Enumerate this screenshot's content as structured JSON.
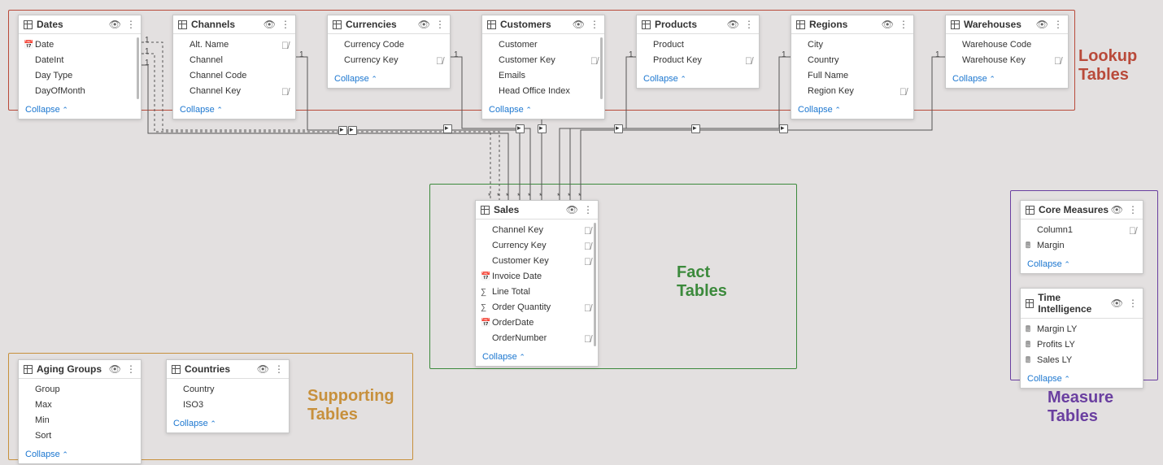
{
  "collapse_label": "Collapse",
  "groups": {
    "lookup": {
      "label": "Lookup\nTables",
      "color": "#b94a3a"
    },
    "fact": {
      "label": "Fact\nTables",
      "color": "#3c8a3c"
    },
    "support": {
      "label": "Supporting\nTables",
      "color": "#c7903c"
    },
    "measure": {
      "label": "Measure\nTables",
      "color": "#6a3fa0"
    }
  },
  "tables": {
    "dates": {
      "title": "Dates",
      "fields": [
        {
          "name": "Date",
          "icon": "date"
        },
        {
          "name": "DateInt"
        },
        {
          "name": "Day Type"
        },
        {
          "name": "DayOfMonth"
        }
      ]
    },
    "channels": {
      "title": "Channels",
      "fields": [
        {
          "name": "Alt. Name",
          "hidden": true
        },
        {
          "name": "Channel"
        },
        {
          "name": "Channel Code"
        },
        {
          "name": "Channel Key",
          "hidden": true
        }
      ]
    },
    "currencies": {
      "title": "Currencies",
      "fields": [
        {
          "name": "Currency Code"
        },
        {
          "name": "Currency Key",
          "hidden": true
        }
      ]
    },
    "customers": {
      "title": "Customers",
      "fields": [
        {
          "name": "Customer"
        },
        {
          "name": "Customer Key",
          "hidden": true
        },
        {
          "name": "Emails"
        },
        {
          "name": "Head Office Index"
        }
      ]
    },
    "products": {
      "title": "Products",
      "fields": [
        {
          "name": "Product"
        },
        {
          "name": "Product Key",
          "hidden": true
        }
      ]
    },
    "regions": {
      "title": "Regions",
      "fields": [
        {
          "name": "City"
        },
        {
          "name": "Country"
        },
        {
          "name": "Full Name"
        },
        {
          "name": "Region Key",
          "hidden": true
        }
      ]
    },
    "warehouses": {
      "title": "Warehouses",
      "fields": [
        {
          "name": "Warehouse Code"
        },
        {
          "name": "Warehouse Key",
          "hidden": true
        }
      ]
    },
    "sales": {
      "title": "Sales",
      "fields": [
        {
          "name": "Channel Key",
          "hidden": true
        },
        {
          "name": "Currency Key",
          "hidden": true
        },
        {
          "name": "Customer Key",
          "hidden": true
        },
        {
          "name": "Invoice Date",
          "icon": "date"
        },
        {
          "name": "Line Total",
          "icon": "sum"
        },
        {
          "name": "Order Quantity",
          "icon": "sum",
          "hidden": true
        },
        {
          "name": "OrderDate",
          "icon": "date"
        },
        {
          "name": "OrderNumber",
          "hidden": true
        }
      ]
    },
    "aging": {
      "title": "Aging Groups",
      "fields": [
        {
          "name": "Group"
        },
        {
          "name": "Max"
        },
        {
          "name": "Min"
        },
        {
          "name": "Sort"
        }
      ]
    },
    "countries": {
      "title": "Countries",
      "fields": [
        {
          "name": "Country"
        },
        {
          "name": "ISO3"
        }
      ]
    },
    "core": {
      "title": "Core Measures",
      "fields": [
        {
          "name": "Column1",
          "hidden": true
        },
        {
          "name": "Margin",
          "icon": "calc"
        }
      ]
    },
    "time": {
      "title": "Time Intelligence",
      "fields": [
        {
          "name": "Margin LY",
          "icon": "calc"
        },
        {
          "name": "Profits LY",
          "icon": "calc"
        },
        {
          "name": "Sales LY",
          "icon": "calc"
        }
      ]
    }
  }
}
